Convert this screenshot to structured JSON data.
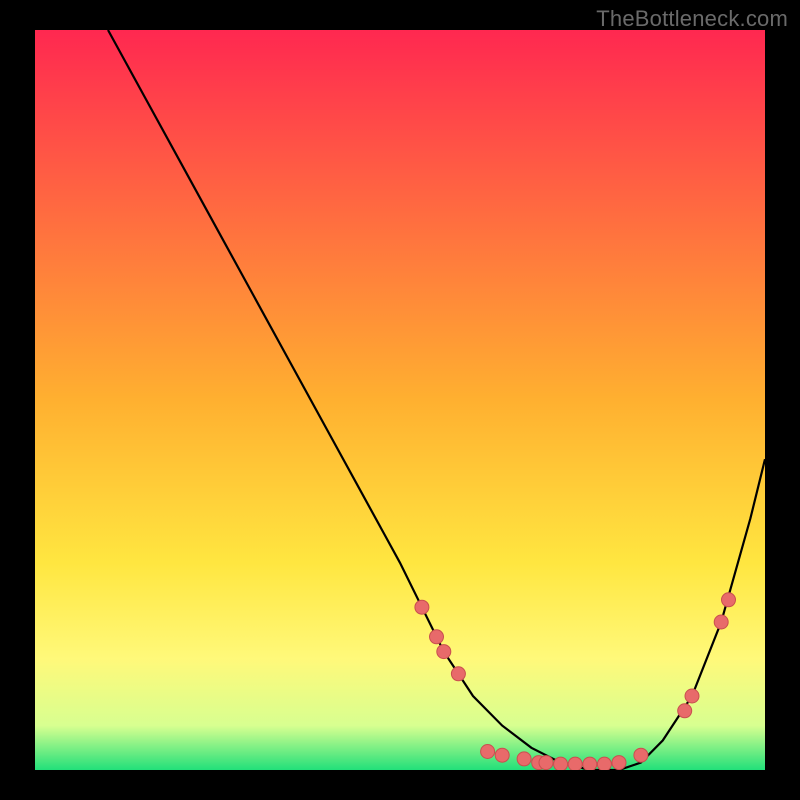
{
  "watermark": "TheBottleneck.com",
  "colors": {
    "gradient_top": "#ff2850",
    "gradient_mid": "#ffe640",
    "gradient_bottom": "#22e07a",
    "curve": "#000000",
    "dot_fill": "#e86a6a",
    "dot_stroke": "#c94f4f"
  },
  "chart_data": {
    "type": "line",
    "title": "",
    "xlabel": "",
    "ylabel": "",
    "xlim": [
      0,
      100
    ],
    "ylim": [
      0,
      100
    ],
    "series": [
      {
        "name": "curve",
        "x": [
          10,
          15,
          20,
          25,
          30,
          35,
          40,
          45,
          50,
          53,
          56,
          60,
          64,
          68,
          72,
          76,
          80,
          83,
          86,
          90,
          94,
          98,
          100
        ],
        "y": [
          100,
          91,
          82,
          73,
          64,
          55,
          46,
          37,
          28,
          22,
          16,
          10,
          6,
          3,
          1,
          0,
          0,
          1,
          4,
          10,
          20,
          34,
          42
        ]
      }
    ],
    "scatter_points": [
      {
        "x": 53,
        "y": 22
      },
      {
        "x": 55,
        "y": 18
      },
      {
        "x": 56,
        "y": 16
      },
      {
        "x": 58,
        "y": 13
      },
      {
        "x": 62,
        "y": 2.5
      },
      {
        "x": 64,
        "y": 2
      },
      {
        "x": 67,
        "y": 1.5
      },
      {
        "x": 69,
        "y": 1
      },
      {
        "x": 70,
        "y": 1
      },
      {
        "x": 72,
        "y": 0.8
      },
      {
        "x": 74,
        "y": 0.8
      },
      {
        "x": 76,
        "y": 0.8
      },
      {
        "x": 78,
        "y": 0.8
      },
      {
        "x": 80,
        "y": 1
      },
      {
        "x": 83,
        "y": 2
      },
      {
        "x": 89,
        "y": 8
      },
      {
        "x": 90,
        "y": 10
      },
      {
        "x": 94,
        "y": 20
      },
      {
        "x": 95,
        "y": 23
      }
    ]
  }
}
